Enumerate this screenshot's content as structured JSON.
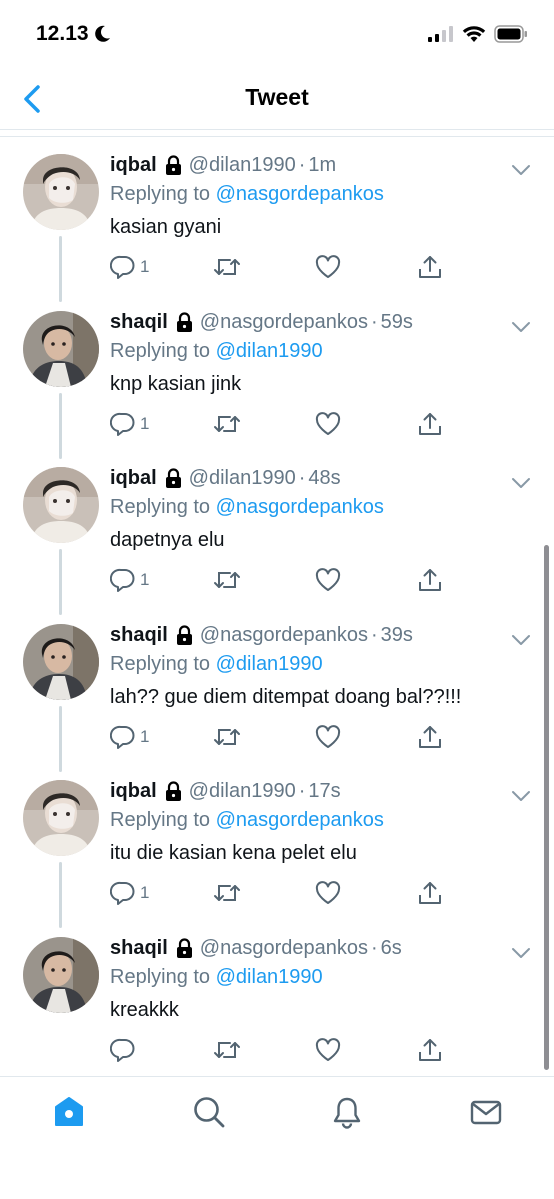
{
  "status_bar": {
    "time": "12.13"
  },
  "header": {
    "title": "Tweet"
  },
  "tweets": [
    {
      "name": "iqbal",
      "handle": "@dilan1990",
      "time": "1m",
      "replying_prefix": "Replying to",
      "replying_to": "@nasgordepankos",
      "text": "kasian gyani",
      "reply_count": "1",
      "avatar": "iqbal"
    },
    {
      "name": "shaqil",
      "handle": "@nasgordepankos",
      "time": "59s",
      "replying_prefix": "Replying to",
      "replying_to": "@dilan1990",
      "text": "knp kasian jink",
      "reply_count": "1",
      "avatar": "shaqil"
    },
    {
      "name": "iqbal",
      "handle": "@dilan1990",
      "time": "48s",
      "replying_prefix": "Replying to",
      "replying_to": "@nasgordepankos",
      "text": "dapetnya elu",
      "reply_count": "1",
      "avatar": "iqbal"
    },
    {
      "name": "shaqil",
      "handle": "@nasgordepankos",
      "time": "39s",
      "replying_prefix": "Replying to",
      "replying_to": "@dilan1990",
      "text": "lah?? gue diem ditempat doang bal??!!!",
      "reply_count": "1",
      "avatar": "shaqil"
    },
    {
      "name": "iqbal",
      "handle": "@dilan1990",
      "time": "17s",
      "replying_prefix": "Replying to",
      "replying_to": "@nasgordepankos",
      "text": "itu die kasian kena pelet elu",
      "reply_count": "1",
      "avatar": "iqbal"
    },
    {
      "name": "shaqil",
      "handle": "@nasgordepankos",
      "time": "6s",
      "replying_prefix": "Replying to",
      "replying_to": "@dilan1990",
      "text": "kreakkk",
      "reply_count": "",
      "avatar": "shaqil"
    }
  ],
  "tab_bar": [
    "home-icon",
    "search-icon",
    "bell-icon",
    "mail-icon"
  ],
  "colors": {
    "accent": "#1d9bf0",
    "muted": "#657786",
    "text": "#0f1419"
  }
}
